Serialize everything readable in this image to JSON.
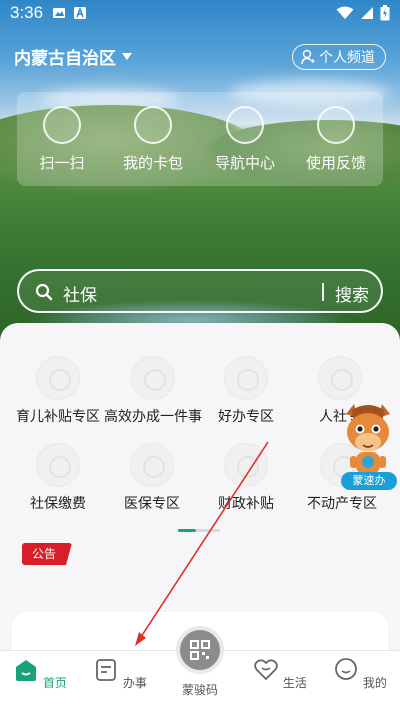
{
  "status_bar": {
    "time": "3:36"
  },
  "header": {
    "region": "内蒙古自治区",
    "channel_label": "个人频道"
  },
  "quick_actions": [
    {
      "label": "扫一扫"
    },
    {
      "label": "我的卡包"
    },
    {
      "label": "导航中心"
    },
    {
      "label": "使用反馈"
    }
  ],
  "search": {
    "query": "社保",
    "button_label": "搜索"
  },
  "services_row1": [
    {
      "label": "育儿补贴专区"
    },
    {
      "label": "高效办成一件事"
    },
    {
      "label": "好办专区"
    },
    {
      "label": "人社专"
    }
  ],
  "services_row2": [
    {
      "label": "社保缴费"
    },
    {
      "label": "医保专区"
    },
    {
      "label": "财政补贴"
    },
    {
      "label": "不动产专区"
    }
  ],
  "notice": {
    "badge": "公告"
  },
  "mascot": {
    "label": "蒙速办"
  },
  "tabbar": [
    {
      "label": "首页",
      "icon": "home-icon",
      "active": true
    },
    {
      "label": "办事",
      "icon": "task-icon",
      "active": false
    },
    {
      "label": "蒙骏码",
      "icon": "qr-code-icon",
      "active": false
    },
    {
      "label": "生活",
      "icon": "heart-icon",
      "active": false
    },
    {
      "label": "我的",
      "icon": "profile-icon",
      "active": false
    }
  ],
  "colors": {
    "accent": "#1aa37a",
    "notice_red": "#d61f29",
    "mascot_blue": "#1a9fd9"
  }
}
